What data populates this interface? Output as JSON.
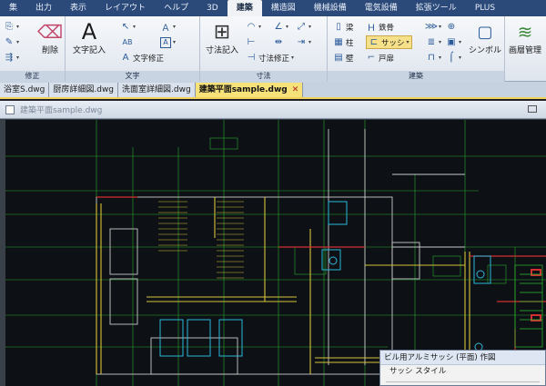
{
  "menu": {
    "tabs": [
      "集",
      "出力",
      "表示",
      "レイアウト",
      "ヘルプ",
      "3D",
      "建築",
      "構造図",
      "機械設備",
      "電気設備",
      "拡張ツール",
      "PLUS"
    ],
    "active_index": 6
  },
  "ribbon": {
    "panels": {
      "modify": "修正",
      "text": "文字",
      "dimension": "寸法",
      "architecture": "建築"
    },
    "buttons": {
      "delete": "削除",
      "text_entry": "文字記入",
      "text_modify": "文字修正",
      "dimension_entry": "寸法記入",
      "dimension_modify": "寸法修正",
      "beam": "梁",
      "steel_frame": "鉄骨",
      "column": "柱",
      "sash": "サッシ",
      "wall": "壁",
      "door": "戸扉",
      "symbol": "シンボル",
      "layer_management": "画層管理"
    },
    "text_icons": [
      "A",
      "A",
      "AB"
    ]
  },
  "doctabs": [
    {
      "label": "浴室S.dwg",
      "active": false
    },
    {
      "label": "厨房詳細図.dwg",
      "active": false
    },
    {
      "label": "洗面室詳細図.dwg",
      "active": false
    },
    {
      "label": "建築平面sample.dwg",
      "active": true
    }
  ],
  "drawing_window": {
    "title": "建築平面sample.dwg"
  },
  "dialog": {
    "title": "ビル用アルミサッシ (平面) 作図",
    "section_label": "サッシ スタイル"
  },
  "colors": {
    "menubar": "#2b4a79",
    "canvas_bg": "#0d1116",
    "line_green": "#2fbf2f",
    "line_yellow": "#d8c23a",
    "line_red": "#d23030",
    "line_cyan": "#2bb6d8",
    "line_white": "#c8c8c8"
  }
}
